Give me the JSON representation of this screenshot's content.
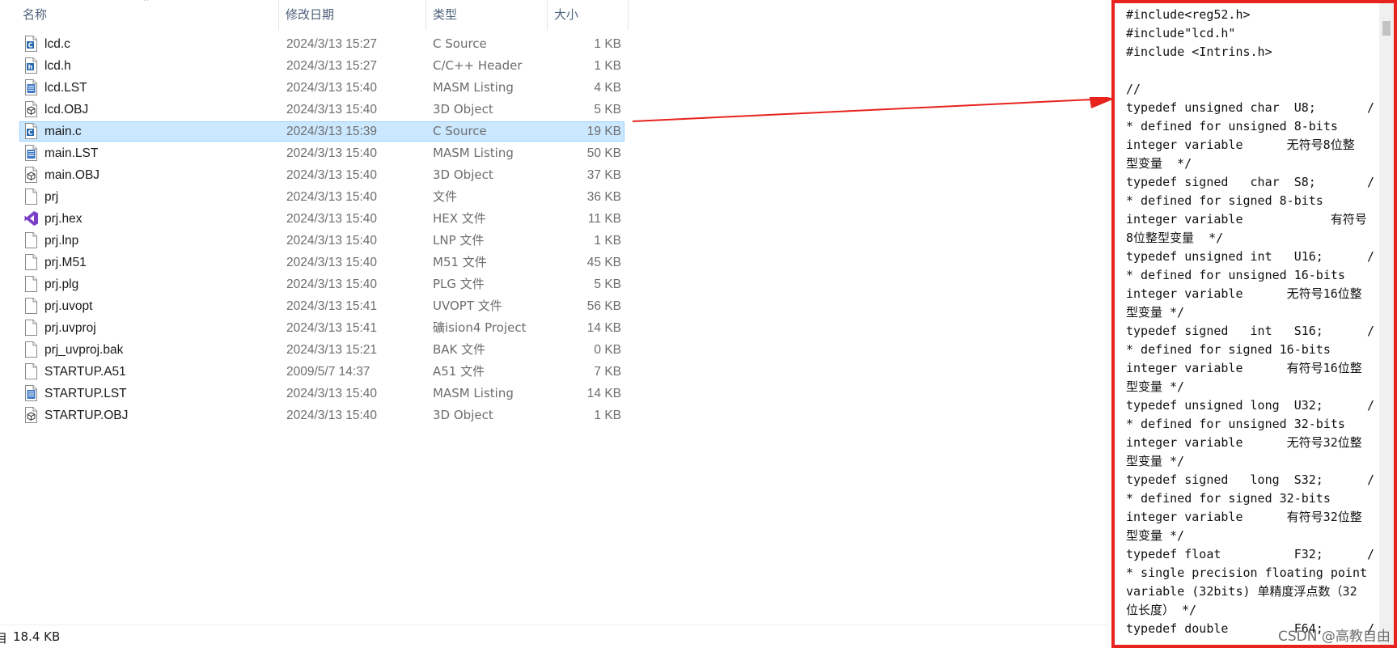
{
  "explorer": {
    "columns": {
      "name": "名称",
      "date": "修改日期",
      "type": "类型",
      "size": "大小"
    },
    "files": [
      {
        "name": "lcd.c",
        "date": "2024/3/13 15:27",
        "type": "C Source",
        "size": "1 KB",
        "icon": "c-source-file-icon"
      },
      {
        "name": "lcd.h",
        "date": "2024/3/13 15:27",
        "type": "C/C++ Header",
        "size": "1 KB",
        "icon": "header-file-icon"
      },
      {
        "name": "lcd.LST",
        "date": "2024/3/13 15:40",
        "type": "MASM Listing",
        "size": "4 KB",
        "icon": "listing-file-icon"
      },
      {
        "name": "lcd.OBJ",
        "date": "2024/3/13 15:40",
        "type": "3D Object",
        "size": "5 KB",
        "icon": "object-file-icon"
      },
      {
        "name": "main.c",
        "date": "2024/3/13 15:39",
        "type": "C Source",
        "size": "19 KB",
        "icon": "c-source-file-icon",
        "selected": true
      },
      {
        "name": "main.LST",
        "date": "2024/3/13 15:40",
        "type": "MASM Listing",
        "size": "50 KB",
        "icon": "listing-file-icon"
      },
      {
        "name": "main.OBJ",
        "date": "2024/3/13 15:40",
        "type": "3D Object",
        "size": "37 KB",
        "icon": "object-file-icon"
      },
      {
        "name": "prj",
        "date": "2024/3/13 15:40",
        "type": "文件",
        "size": "36 KB",
        "icon": "blank-file-icon"
      },
      {
        "name": "prj.hex",
        "date": "2024/3/13 15:40",
        "type": "HEX 文件",
        "size": "11 KB",
        "icon": "visual-studio-icon"
      },
      {
        "name": "prj.lnp",
        "date": "2024/3/13 15:40",
        "type": "LNP 文件",
        "size": "1 KB",
        "icon": "blank-file-icon"
      },
      {
        "name": "prj.M51",
        "date": "2024/3/13 15:40",
        "type": "M51 文件",
        "size": "45 KB",
        "icon": "blank-file-icon"
      },
      {
        "name": "prj.plg",
        "date": "2024/3/13 15:40",
        "type": "PLG 文件",
        "size": "5 KB",
        "icon": "blank-file-icon"
      },
      {
        "name": "prj.uvopt",
        "date": "2024/3/13 15:41",
        "type": "UVOPT 文件",
        "size": "56 KB",
        "icon": "blank-file-icon"
      },
      {
        "name": "prj.uvproj",
        "date": "2024/3/13 15:41",
        "type": "礦ision4 Project",
        "size": "14 KB",
        "icon": "blank-file-icon"
      },
      {
        "name": "prj_uvproj.bak",
        "date": "2024/3/13 15:21",
        "type": "BAK 文件",
        "size": "0 KB",
        "icon": "blank-file-icon"
      },
      {
        "name": "STARTUP.A51",
        "date": "2009/5/7 14:37",
        "type": "A51 文件",
        "size": "7 KB",
        "icon": "blank-file-icon"
      },
      {
        "name": "STARTUP.LST",
        "date": "2024/3/13 15:40",
        "type": "MASM Listing",
        "size": "14 KB",
        "icon": "listing-file-icon"
      },
      {
        "name": "STARTUP.OBJ",
        "date": "2024/3/13 15:40",
        "type": "3D Object",
        "size": "1 KB",
        "icon": "object-file-icon"
      }
    ],
    "status": {
      "items_fragment": "目",
      "size": "18.4 KB"
    }
  },
  "code_panel": {
    "lines": [
      "#include<reg52.h>",
      "#include\"lcd.h\"",
      "#include <Intrins.h>",
      "",
      "//",
      "typedef unsigned char  U8;       /",
      "* defined for unsigned 8-bits",
      "integer variable      无符号8位整",
      "型变量  */",
      "typedef signed   char  S8;       /",
      "* defined for signed 8-bits",
      "integer variable            有符号",
      "8位整型变量  */",
      "typedef unsigned int   U16;      /",
      "* defined for unsigned 16-bits",
      "integer variable      无符号16位整",
      "型变量 */",
      "typedef signed   int   S16;      /",
      "* defined for signed 16-bits",
      "integer variable      有符号16位整",
      "型变量 */",
      "typedef unsigned long  U32;      /",
      "* defined for unsigned 32-bits",
      "integer variable      无符号32位整",
      "型变量 */",
      "typedef signed   long  S32;      /",
      "* defined for signed 32-bits",
      "integer variable      有符号32位整",
      "型变量 */",
      "typedef float          F32;      /",
      "* single precision floating point",
      "variable (32bits) 单精度浮点数（32",
      "位长度） */",
      "typedef double         F64;      /"
    ],
    "border_color": "#e8221d"
  },
  "watermark": "CSDN @高教自由",
  "colors": {
    "selection": "#cce8ff",
    "arrow": "#e8221d",
    "header_text": "#4c607a"
  }
}
